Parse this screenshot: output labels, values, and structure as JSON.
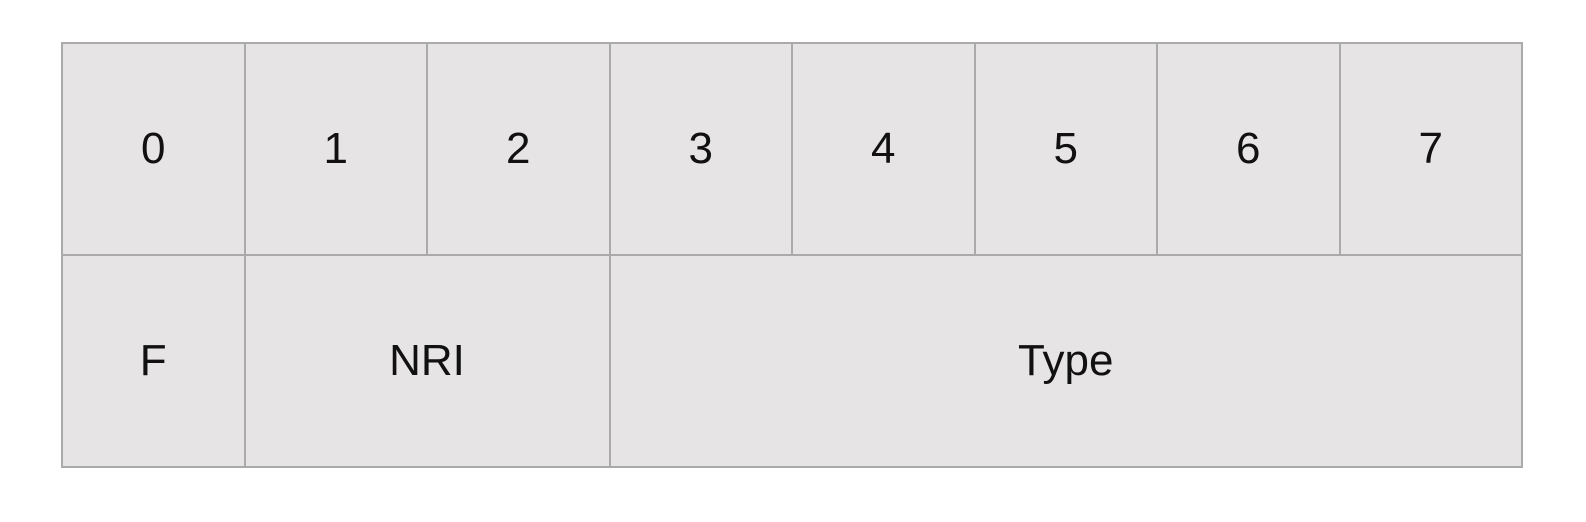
{
  "diagram": {
    "bit_numbers": [
      "0",
      "1",
      "2",
      "3",
      "4",
      "5",
      "6",
      "7"
    ],
    "fields": [
      {
        "label": "F",
        "bits": 1
      },
      {
        "label": "NRI",
        "bits": 2
      },
      {
        "label": "Type",
        "bits": 5
      }
    ],
    "colors": {
      "cell_fill": "#e6e4e5",
      "border": "#aaaaaa",
      "text": "#111111"
    }
  }
}
